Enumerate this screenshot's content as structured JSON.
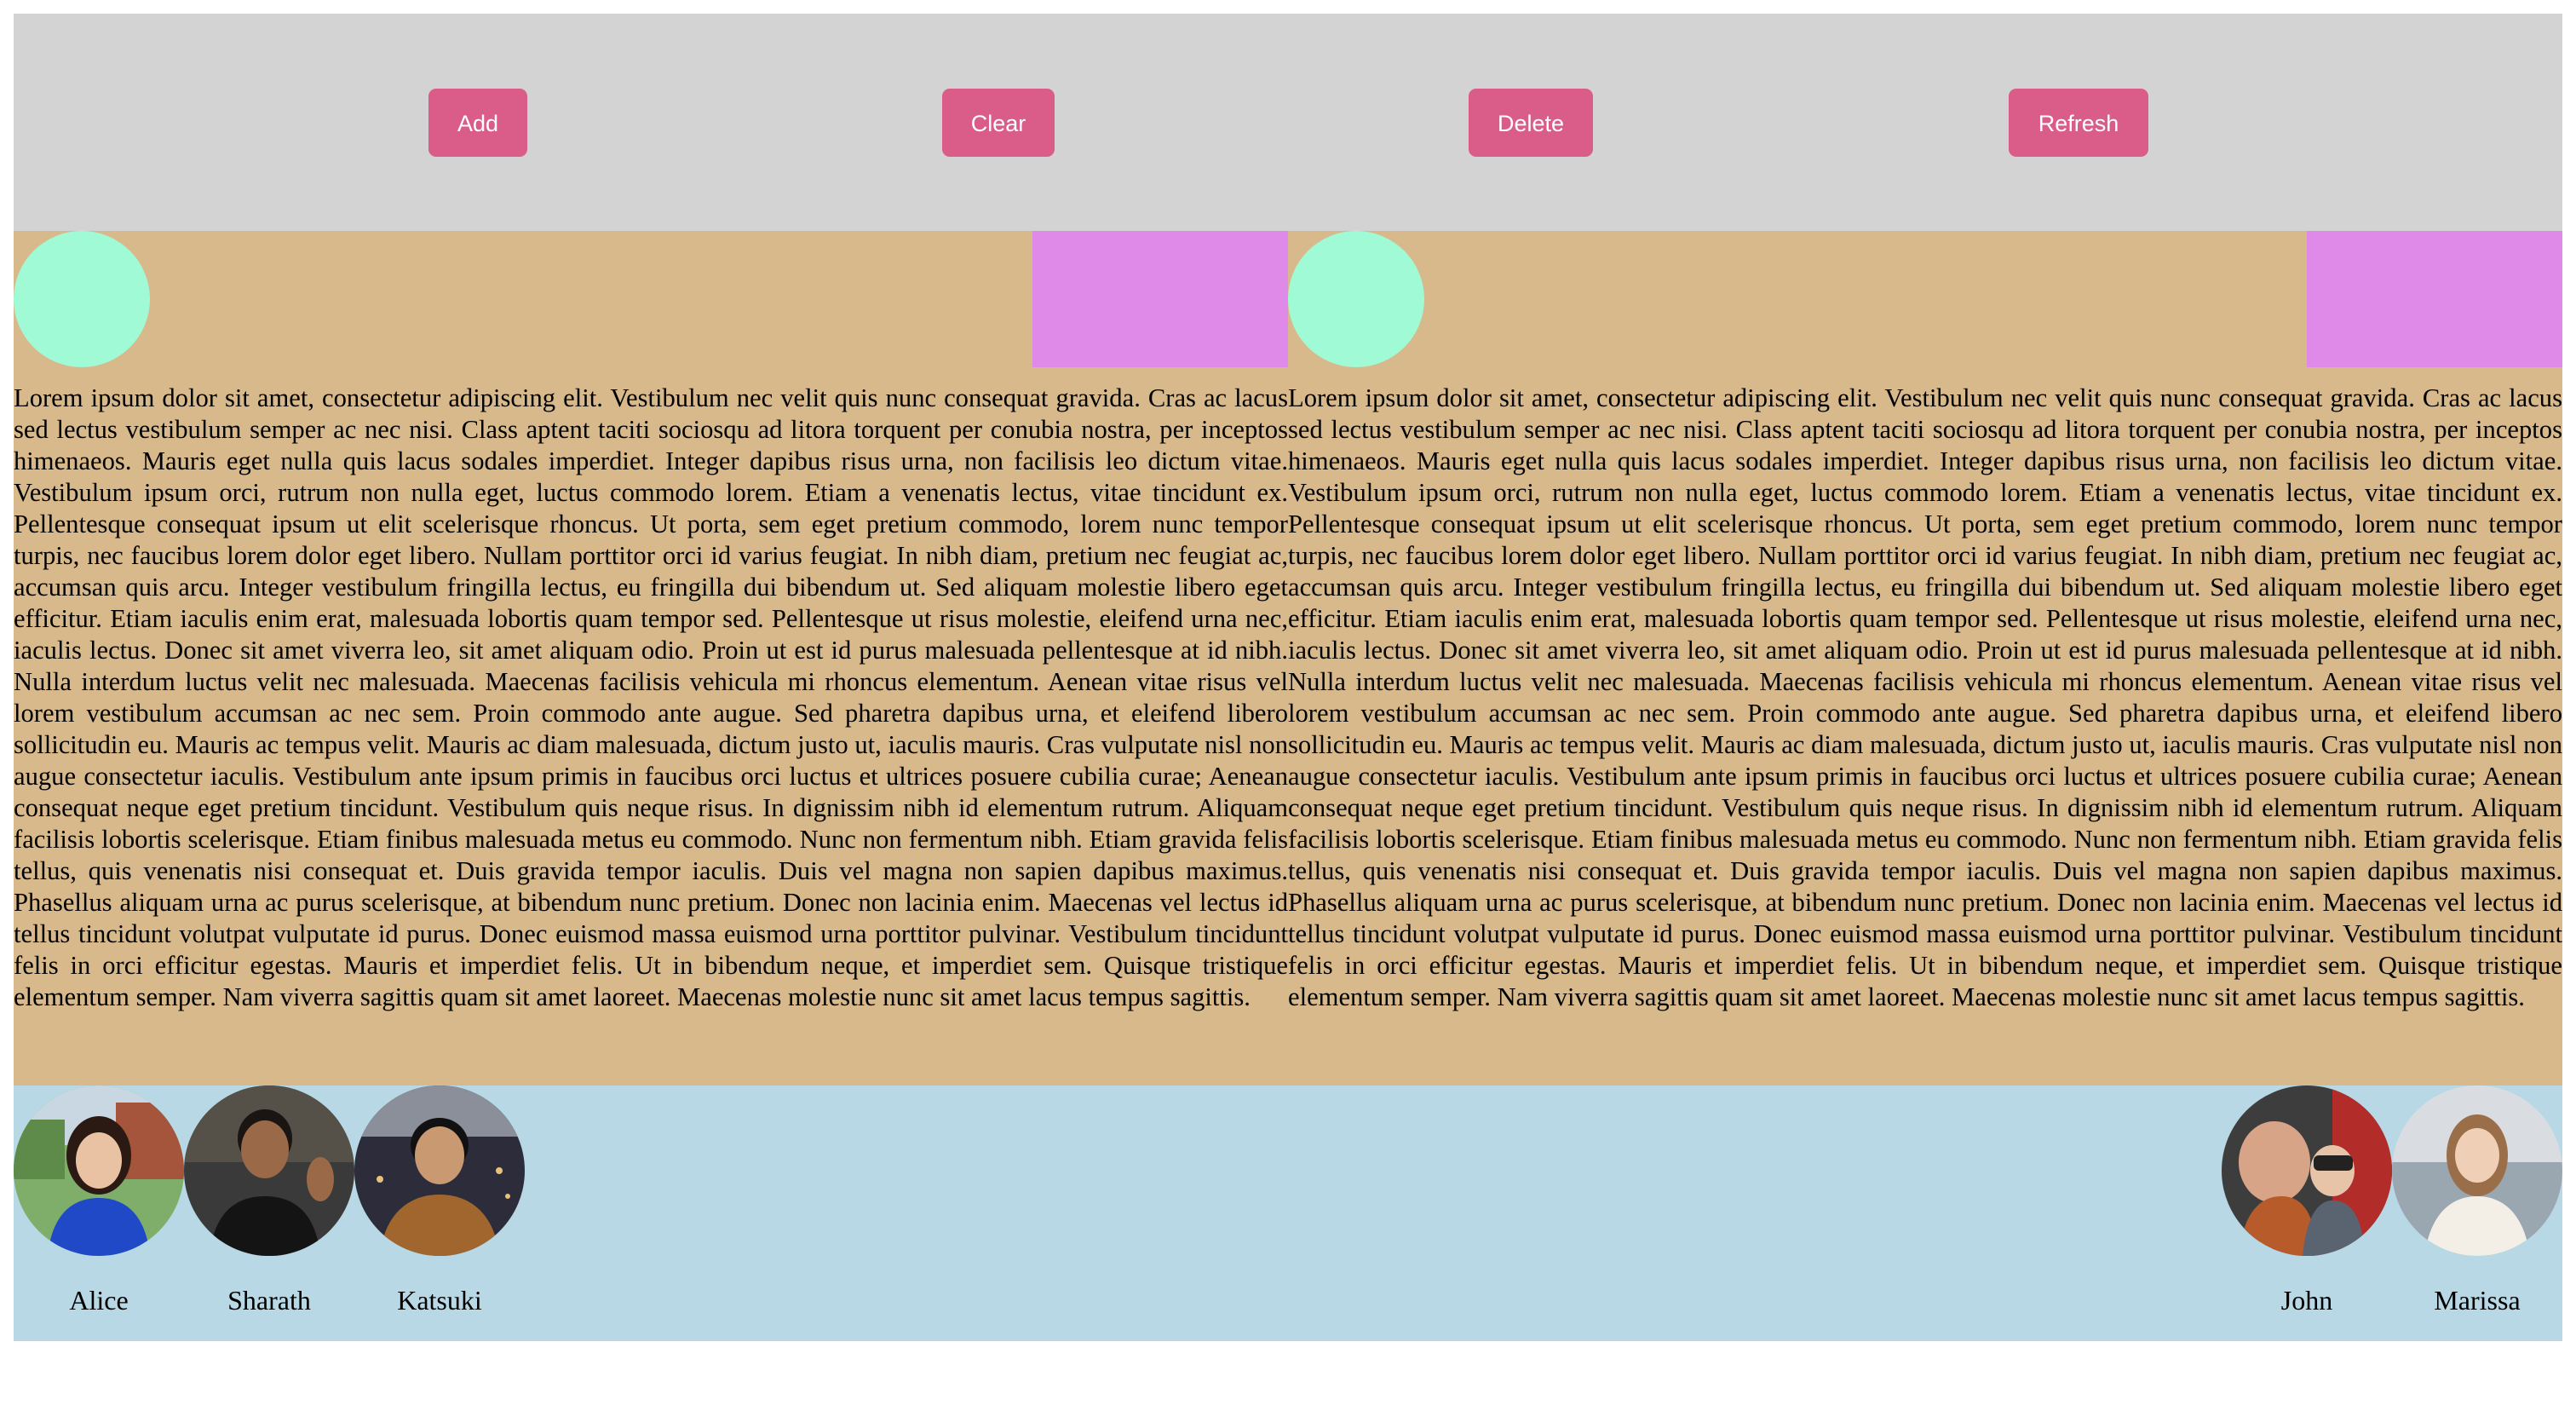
{
  "toolbar": {
    "buttons": [
      {
        "label": "Add"
      },
      {
        "label": "Clear"
      },
      {
        "label": "Delete"
      },
      {
        "label": "Refresh"
      }
    ]
  },
  "content": {
    "columns": [
      {
        "text": "Lorem ipsum dolor sit amet, consectetur adipiscing elit. Vestibulum nec velit quis nunc consequat gravida. Cras ac lacus sed lectus vestibulum semper ac nec nisi. Class aptent taciti sociosqu ad litora torquent per conubia nostra, per inceptos himenaeos. Mauris eget nulla quis lacus sodales imperdiet. Integer dapibus risus urna, non facilisis leo dictum vitae. Vestibulum ipsum orci, rutrum non nulla eget, luctus commodo lorem. Etiam a venenatis lectus, vitae tincidunt ex. Pellentesque consequat ipsum ut elit scelerisque rhoncus. Ut porta, sem eget pretium commodo, lorem nunc tempor turpis, nec faucibus lorem dolor eget libero. Nullam porttitor orci id varius feugiat. In nibh diam, pretium nec feugiat ac, accumsan quis arcu. Integer vestibulum fringilla lectus, eu fringilla dui bibendum ut. Sed aliquam molestie libero eget efficitur. Etiam iaculis enim erat, malesuada lobortis quam tempor sed. Pellentesque ut risus molestie, eleifend urna nec, iaculis lectus. Donec sit amet viverra leo, sit amet aliquam odio. Proin ut est id purus malesuada pellentesque at id nibh. Nulla interdum luctus velit nec malesuada. Maecenas facilisis vehicula mi rhoncus elementum. Aenean vitae risus vel lorem vestibulum accumsan ac nec sem. Proin commodo ante augue. Sed pharetra dapibus urna, et eleifend libero sollicitudin eu. Mauris ac tempus velit. Mauris ac diam malesuada, dictum justo ut, iaculis mauris. Cras vulputate nisl non augue consectetur iaculis. Vestibulum ante ipsum primis in faucibus orci luctus et ultrices posuere cubilia curae; Aenean consequat neque eget pretium tincidunt. Vestibulum quis neque risus. In dignissim nibh id elementum rutrum. Aliquam facilisis lobortis scelerisque. Etiam finibus malesuada metus eu commodo. Nunc non fermentum nibh. Etiam gravida felis tellus, quis venenatis nisi consequat et. Duis gravida tempor iaculis. Duis vel magna non sapien dapibus maximus. Phasellus aliquam urna ac purus scelerisque, at bibendum nunc pretium. Donec non lacinia enim. Maecenas vel lectus id tellus tincidunt volutpat vulputate id purus. Donec euismod massa euismod urna porttitor pulvinar. Vestibulum tincidunt felis in orci efficitur egestas. Mauris et imperdiet felis. Ut in bibendum neque, et imperdiet sem. Quisque tristique elementum semper. Nam viverra sagittis quam sit amet laoreet. Maecenas molestie nunc sit amet lacus tempus sagittis."
      },
      {
        "text": "Lorem ipsum dolor sit amet, consectetur adipiscing elit. Vestibulum nec velit quis nunc consequat gravida. Cras ac lacus sed lectus vestibulum semper ac nec nisi. Class aptent taciti sociosqu ad litora torquent per conubia nostra, per inceptos himenaeos. Mauris eget nulla quis lacus sodales imperdiet. Integer dapibus risus urna, non facilisis leo dictum vitae. Vestibulum ipsum orci, rutrum non nulla eget, luctus commodo lorem. Etiam a venenatis lectus, vitae tincidunt ex. Pellentesque consequat ipsum ut elit scelerisque rhoncus. Ut porta, sem eget pretium commodo, lorem nunc tempor turpis, nec faucibus lorem dolor eget libero. Nullam porttitor orci id varius feugiat. In nibh diam, pretium nec feugiat ac, accumsan quis arcu. Integer vestibulum fringilla lectus, eu fringilla dui bibendum ut. Sed aliquam molestie libero eget efficitur. Etiam iaculis enim erat, malesuada lobortis quam tempor sed. Pellentesque ut risus molestie, eleifend urna nec, iaculis lectus. Donec sit amet viverra leo, sit amet aliquam odio. Proin ut est id purus malesuada pellentesque at id nibh. Nulla interdum luctus velit nec malesuada. Maecenas facilisis vehicula mi rhoncus elementum. Aenean vitae risus vel lorem vestibulum accumsan ac nec sem. Proin commodo ante augue. Sed pharetra dapibus urna, et eleifend libero sollicitudin eu. Mauris ac tempus velit. Mauris ac diam malesuada, dictum justo ut, iaculis mauris. Cras vulputate nisl non augue consectetur iaculis. Vestibulum ante ipsum primis in faucibus orci luctus et ultrices posuere cubilia curae; Aenean consequat neque eget pretium tincidunt. Vestibulum quis neque risus. In dignissim nibh id elementum rutrum. Aliquam facilisis lobortis scelerisque. Etiam finibus malesuada metus eu commodo. Nunc non fermentum nibh. Etiam gravida felis tellus, quis venenatis nisi consequat et. Duis gravida tempor iaculis. Duis vel magna non sapien dapibus maximus. Phasellus aliquam urna ac purus scelerisque, at bibendum nunc pretium. Donec non lacinia enim. Maecenas vel lectus id tellus tincidunt volutpat vulputate id purus. Donec euismod massa euismod urna porttitor pulvinar. Vestibulum tincidunt felis in orci efficitur egestas. Mauris et imperdiet felis. Ut in bibendum neque, et imperdiet sem. Quisque tristique elementum semper. Nam viverra sagittis quam sit amet laoreet. Maecenas molestie nunc sit amet lacus tempus sagittis."
      }
    ]
  },
  "people": [
    {
      "name": "Alice"
    },
    {
      "name": "Sharath"
    },
    {
      "name": "Katsuki"
    },
    {
      "name": "John"
    },
    {
      "name": "Marissa"
    }
  ],
  "colors": {
    "toolbar_bg": "#d3d3d3",
    "button_bg": "#d95c89",
    "content_bg": "#d8b98c",
    "circle": "#a0fad6",
    "rect": "#df89e8",
    "people_bg": "#b7d8e4"
  }
}
